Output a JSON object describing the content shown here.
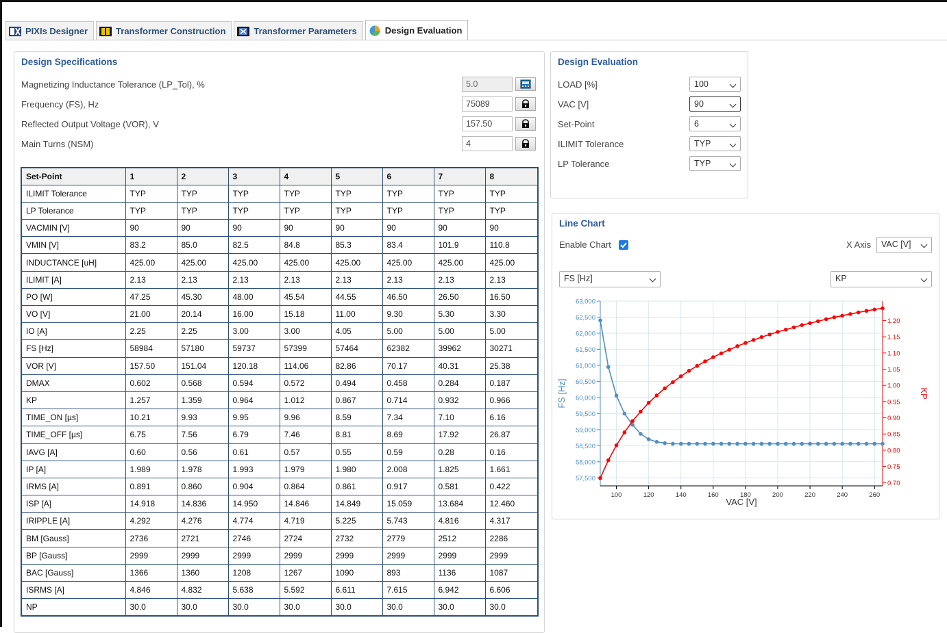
{
  "tabs": [
    {
      "label": "PIXIs Designer",
      "icon": "pixis-designer-icon"
    },
    {
      "label": "Transformer Construction",
      "icon": "transformer-construction-icon"
    },
    {
      "label": "Transformer Parameters",
      "icon": "transformer-parameters-icon"
    },
    {
      "label": "Design Evaluation",
      "icon": "pie-chart-icon",
      "active": true
    }
  ],
  "specs": {
    "title": "Design Specifications",
    "fields": [
      {
        "label": "Magnetizing Inductance Tolerance (LP_Tol), %",
        "value": "5.0",
        "disabled": true,
        "button_icon": "calculator-icon"
      },
      {
        "label": "Frequency (FS), Hz",
        "value": "75089",
        "disabled": false,
        "button_icon": "lock-icon"
      },
      {
        "label": "Reflected Output Voltage (VOR), V",
        "value": "157.50",
        "disabled": false,
        "button_icon": "lock-icon"
      },
      {
        "label": "Main Turns (NSM)",
        "value": "4",
        "disabled": false,
        "button_icon": "lock-icon"
      }
    ]
  },
  "table": {
    "headers": [
      "Set-Point",
      "1",
      "2",
      "3",
      "4",
      "5",
      "6",
      "7",
      "8"
    ],
    "rows": [
      [
        "ILIMIT Tolerance",
        "TYP",
        "TYP",
        "TYP",
        "TYP",
        "TYP",
        "TYP",
        "TYP",
        "TYP"
      ],
      [
        "LP Tolerance",
        "TYP",
        "TYP",
        "TYP",
        "TYP",
        "TYP",
        "TYP",
        "TYP",
        "TYP"
      ],
      [
        "VACMIN [V]",
        "90",
        "90",
        "90",
        "90",
        "90",
        "90",
        "90",
        "90"
      ],
      [
        "VMIN [V]",
        "83.2",
        "85.0",
        "82.5",
        "84.8",
        "85.3",
        "83.4",
        "101.9",
        "110.8"
      ],
      [
        "INDUCTANCE [uH]",
        "425.00",
        "425.00",
        "425.00",
        "425.00",
        "425.00",
        "425.00",
        "425.00",
        "425.00"
      ],
      [
        "ILIMIT [A]",
        "2.13",
        "2.13",
        "2.13",
        "2.13",
        "2.13",
        "2.13",
        "2.13",
        "2.13"
      ],
      [
        "PO [W]",
        "47.25",
        "45.30",
        "48.00",
        "45.54",
        "44.55",
        "46.50",
        "26.50",
        "16.50"
      ],
      [
        "VO [V]",
        "21.00",
        "20.14",
        "16.00",
        "15.18",
        "11.00",
        "9.30",
        "5.30",
        "3.30"
      ],
      [
        "IO [A]",
        "2.25",
        "2.25",
        "3.00",
        "3.00",
        "4.05",
        "5.00",
        "5.00",
        "5.00"
      ],
      [
        "FS [Hz]",
        "58984",
        "57180",
        "59737",
        "57399",
        "57464",
        "62382",
        "39962",
        "30271"
      ],
      [
        "VOR [V]",
        "157.50",
        "151.04",
        "120.18",
        "114.06",
        "82.86",
        "70.17",
        "40.31",
        "25.38"
      ],
      [
        "DMAX",
        "0.602",
        "0.568",
        "0.594",
        "0.572",
        "0.494",
        "0.458",
        "0.284",
        "0.187"
      ],
      [
        "KP",
        "1.257",
        "1.359",
        "0.964",
        "1.012",
        "0.867",
        "0.714",
        "0.932",
        "0.966"
      ],
      [
        "TIME_ON [µs]",
        "10.21",
        "9.93",
        "9.95",
        "9.96",
        "8.59",
        "7.34",
        "7.10",
        "6.16"
      ],
      [
        "TIME_OFF [µs]",
        "6.75",
        "7.56",
        "6.79",
        "7.46",
        "8.81",
        "8.69",
        "17.92",
        "26.87"
      ],
      [
        "IAVG [A]",
        "0.60",
        "0.56",
        "0.61",
        "0.57",
        "0.55",
        "0.59",
        "0.28",
        "0.16"
      ],
      [
        "IP [A]",
        "1.989",
        "1.978",
        "1.993",
        "1.979",
        "1.980",
        "2.008",
        "1.825",
        "1.661"
      ],
      [
        "IRMS [A]",
        "0.891",
        "0.860",
        "0.904",
        "0.864",
        "0.861",
        "0.917",
        "0.581",
        "0.422"
      ],
      [
        "ISP [A]",
        "14.918",
        "14.836",
        "14.950",
        "14.846",
        "14.849",
        "15.059",
        "13.684",
        "12.460"
      ],
      [
        "IRIPPLE [A]",
        "4.292",
        "4.276",
        "4.774",
        "4.719",
        "5.225",
        "5.743",
        "4.816",
        "4.317"
      ],
      [
        "BM [Gauss]",
        "2736",
        "2721",
        "2746",
        "2724",
        "2732",
        "2779",
        "2512",
        "2286"
      ],
      [
        "BP [Gauss]",
        "2999",
        "2999",
        "2999",
        "2999",
        "2999",
        "2999",
        "2999",
        "2999"
      ],
      [
        "BAC [Gauss]",
        "1366",
        "1360",
        "1208",
        "1267",
        "1090",
        "893",
        "1136",
        "1087"
      ],
      [
        "ISRMS [A]",
        "4.846",
        "4.832",
        "5.638",
        "5.592",
        "6.611",
        "7.615",
        "6.942",
        "6.606"
      ],
      [
        "NP",
        "30.0",
        "30.0",
        "30.0",
        "30.0",
        "30.0",
        "30.0",
        "30.0",
        "30.0"
      ]
    ]
  },
  "evaluation": {
    "title": "Design Evaluation",
    "fields": [
      {
        "label": "LOAD [%]",
        "value": "100"
      },
      {
        "label": "VAC [V]",
        "value": "90"
      },
      {
        "label": "Set-Point",
        "value": "6"
      },
      {
        "label": "ILIMIT Tolerance",
        "value": "TYP"
      },
      {
        "label": "LP Tolerance",
        "value": "TYP"
      }
    ]
  },
  "line_chart_panel": {
    "title": "Line Chart",
    "enable_label": "Enable Chart",
    "enable_checked": true,
    "xaxis_label": "X Axis",
    "xaxis_value": "VAC [V]",
    "left_series_select": "FS [Hz]",
    "right_series_select": "KP"
  },
  "colors": {
    "fs_series": "#4f8fc0",
    "kp_series": "#ff0000",
    "title_blue": "#2d5aa0",
    "table_border": "#2c4f7c"
  },
  "chart_data": {
    "type": "line",
    "xlabel": "VAC [V]",
    "ylabel_left": "FS [Hz]",
    "ylabel_right": "KP",
    "xlim": [
      90,
      265
    ],
    "ylim_left": [
      57250,
      63000
    ],
    "ylim_right": [
      0.69,
      1.26
    ],
    "x_ticks": [
      100,
      120,
      140,
      160,
      180,
      200,
      220,
      240,
      260
    ],
    "y_left_ticks": [
      57500,
      58000,
      58500,
      59000,
      59500,
      60000,
      60500,
      61000,
      61500,
      62000,
      62500,
      63000
    ],
    "y_left_tick_labels": [
      "57,500",
      "58,000",
      "58,500",
      "59,000",
      "59,500",
      "60,000",
      "60,500",
      "61,000",
      "61,500",
      "62,000",
      "62,500",
      "63,000"
    ],
    "y_right_ticks": [
      0.7,
      0.75,
      0.8,
      0.85,
      0.9,
      0.95,
      1.0,
      1.05,
      1.1,
      1.15,
      1.2
    ],
    "y_right_tick_labels": [
      "0.70",
      "0.75",
      "0.80",
      "0.85",
      "0.90",
      "0.95",
      "1.00",
      "1.05",
      "1.10",
      "1.15",
      "1.20"
    ],
    "grid": true,
    "x": [
      90,
      95,
      100,
      105,
      110,
      115,
      120,
      125,
      130,
      135,
      140,
      145,
      150,
      155,
      160,
      165,
      170,
      175,
      180,
      185,
      190,
      195,
      200,
      205,
      210,
      215,
      220,
      225,
      230,
      235,
      240,
      245,
      250,
      255,
      260,
      265
    ],
    "series": [
      {
        "name": "FS [Hz]",
        "axis": "left",
        "values": [
          62400,
          60950,
          60060,
          59500,
          59150,
          58870,
          58700,
          58620,
          58580,
          58560,
          58560,
          58560,
          58560,
          58560,
          58560,
          58560,
          58560,
          58560,
          58560,
          58560,
          58560,
          58560,
          58560,
          58560,
          58560,
          58560,
          58560,
          58560,
          58560,
          58560,
          58560,
          58560,
          58560,
          58560,
          58560,
          58560
        ]
      },
      {
        "name": "KP",
        "axis": "right",
        "values": [
          0.714,
          0.769,
          0.815,
          0.855,
          0.89,
          0.919,
          0.946,
          0.969,
          0.991,
          1.01,
          1.028,
          1.045,
          1.06,
          1.074,
          1.087,
          1.099,
          1.11,
          1.121,
          1.131,
          1.14,
          1.149,
          1.157,
          1.165,
          1.172,
          1.179,
          1.186,
          1.192,
          1.198,
          1.204,
          1.21,
          1.215,
          1.22,
          1.225,
          1.23,
          1.234,
          1.238
        ]
      }
    ]
  }
}
